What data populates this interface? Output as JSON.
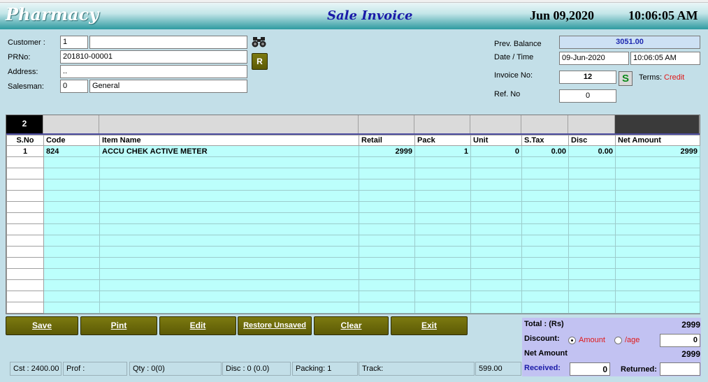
{
  "header": {
    "app_title": "Pharmacy",
    "form_title": "Sale Invoice",
    "date": "Jun 09,2020",
    "time": "10:06:05 AM"
  },
  "left_form": {
    "customer_label": "Customer :",
    "customer_code": "1",
    "customer_name": "",
    "prno_label": "PRNo:",
    "prno_value": "201810-00001",
    "address_label": "Address:",
    "address_value": "..",
    "salesman_label": "Salesman:",
    "salesman_code": "0",
    "salesman_name": "General",
    "r_button": "R"
  },
  "right_form": {
    "prev_balance_label": "Prev. Balance",
    "prev_balance_value": "3051.00",
    "datetime_label": "Date / Time",
    "date_value": "09-Jun-2020",
    "time_value": "10:06:05 AM",
    "invoice_no_label": "Invoice No:",
    "invoice_no_value": "12",
    "s_button": "S",
    "terms_label": "Terms:",
    "terms_value": "Credit",
    "ref_no_label": "Ref. No",
    "ref_no_value": "0"
  },
  "grid": {
    "item_count": "2",
    "columns": [
      "S.No",
      "Code",
      "Item Name",
      "Retail",
      "Pack",
      "Unit",
      "S.Tax",
      "Disc",
      "Net Amount"
    ],
    "rows": [
      {
        "sno": "1",
        "code": "824",
        "name": "ACCU CHEK ACTIVE METER",
        "retail": "2999",
        "pack": "1",
        "unit": "0",
        "stax": "0.00",
        "disc": "0.00",
        "net": "2999"
      }
    ]
  },
  "buttons": {
    "save": "Save",
    "print": "Pint",
    "edit": "Edit",
    "restore": "Restore Unsaved",
    "clear": "Clear",
    "exit": "Exit"
  },
  "totals": {
    "total_label": "Total : (Rs)",
    "total_value": "2999",
    "discount_label": "Discount:",
    "amount_option": "Amount",
    "percent_option": "/age",
    "discount_value": "0",
    "net_amount_label": "Net Amount",
    "net_amount_value": "2999",
    "received_label": "Received:",
    "received_value": "0",
    "returned_label": "Returned:",
    "returned_value": ""
  },
  "status_bar": {
    "cst": "Cst : 2400.00",
    "prof": "Prof :",
    "qty": "Qty : 0(0)",
    "disc": "Disc : 0 (0.0)",
    "packing": "Packing:   1",
    "track": "Track:",
    "amount": "599.00"
  },
  "colors": {
    "accent_olive": "#6b690a",
    "grid_row": "#bcfffc",
    "totals_bg": "#c2c2f2",
    "terms_red": "#e01818"
  }
}
